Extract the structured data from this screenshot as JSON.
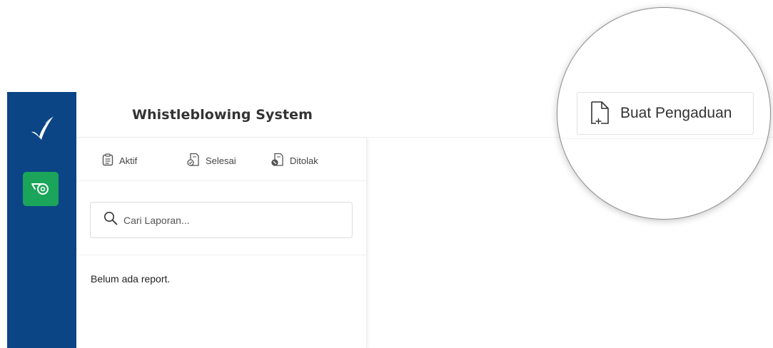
{
  "app": {
    "title": "Whistleblowing System"
  },
  "sidebar": {
    "logo_icon": "checkmark-logo-icon",
    "items": [
      {
        "icon": "whistle-icon",
        "active": true,
        "color": "#1aa55a"
      }
    ],
    "background": "#0b4585"
  },
  "tabs": [
    {
      "label": "Aktif",
      "icon": "clipboard-icon"
    },
    {
      "label": "Selesai",
      "icon": "document-check-icon"
    },
    {
      "label": "Ditolak",
      "icon": "document-reject-icon"
    }
  ],
  "search": {
    "placeholder": "Cari Laporan...",
    "value": ""
  },
  "reports": {
    "empty_message": "Belum ada report."
  },
  "toolbar": {
    "create_label": "Buat Pengaduan",
    "create_icon": "new-file-icon"
  }
}
